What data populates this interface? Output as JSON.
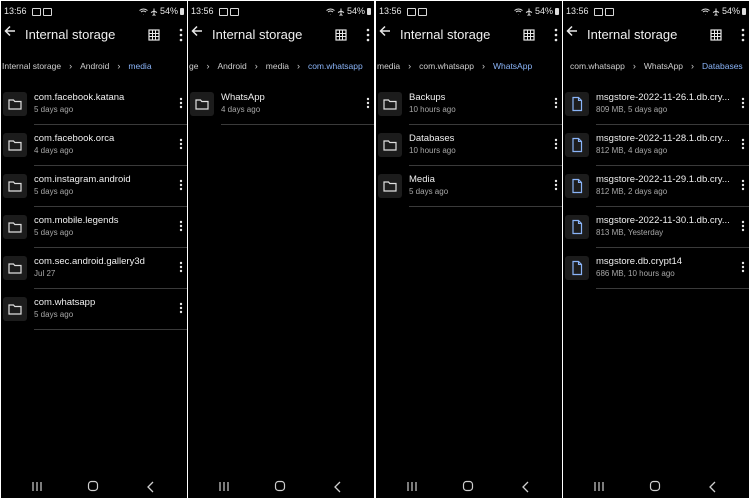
{
  "status_bar": {
    "time": "13:56",
    "battery": "54%"
  },
  "app": {
    "title": "Internal storage"
  },
  "panels": [
    {
      "breadcrumbs": [
        "Internal storage",
        "Android",
        "media"
      ],
      "items": [
        {
          "name": "com.facebook.katana",
          "meta": "5 days ago",
          "icon": "folder-icon"
        },
        {
          "name": "com.facebook.orca",
          "meta": "4 days ago",
          "icon": "folder-icon"
        },
        {
          "name": "com.instagram.android",
          "meta": "5 days ago",
          "icon": "folder-icon"
        },
        {
          "name": "com.mobile.legends",
          "meta": "5 days ago",
          "icon": "folder-icon"
        },
        {
          "name": "com.sec.android.gallery3d",
          "meta": "Jul 27",
          "icon": "folder-icon"
        },
        {
          "name": "com.whatsapp",
          "meta": "5 days ago",
          "icon": "folder-icon"
        }
      ]
    },
    {
      "breadcrumbs": [
        "ge",
        "Android",
        "media",
        "com.whatsapp"
      ],
      "items": [
        {
          "name": "WhatsApp",
          "meta": "4 days ago",
          "icon": "folder-icon"
        }
      ]
    },
    {
      "breadcrumbs": [
        "media",
        "com.whatsapp",
        "WhatsApp"
      ],
      "items": [
        {
          "name": "Backups",
          "meta": "10 hours ago",
          "icon": "folder-icon"
        },
        {
          "name": "Databases",
          "meta": "10 hours ago",
          "icon": "folder-icon"
        },
        {
          "name": "Media",
          "meta": "5 days ago",
          "icon": "folder-icon"
        }
      ]
    },
    {
      "breadcrumbs": [
        "com.whatsapp",
        "WhatsApp",
        "Databases"
      ],
      "items": [
        {
          "name": "msgstore-2022-11-26.1.db.cry...",
          "meta": "809 MB, 5 days ago",
          "icon": "file-icon"
        },
        {
          "name": "msgstore-2022-11-28.1.db.cry...",
          "meta": "812 MB, 4 days ago",
          "icon": "file-icon"
        },
        {
          "name": "msgstore-2022-11-29.1.db.cry...",
          "meta": "812 MB, 2 days ago",
          "icon": "file-icon"
        },
        {
          "name": "msgstore-2022-11-30.1.db.cry...",
          "meta": "813 MB, Yesterday",
          "icon": "file-icon"
        },
        {
          "name": "msgstore.db.crypt14",
          "meta": "686 MB, 10 hours ago",
          "icon": "file-icon"
        }
      ]
    }
  ],
  "colors": {
    "background": "#000000",
    "accent": "#8ab4f8",
    "text": "#f0f0f0",
    "secondary_text": "#a8a8a8"
  }
}
